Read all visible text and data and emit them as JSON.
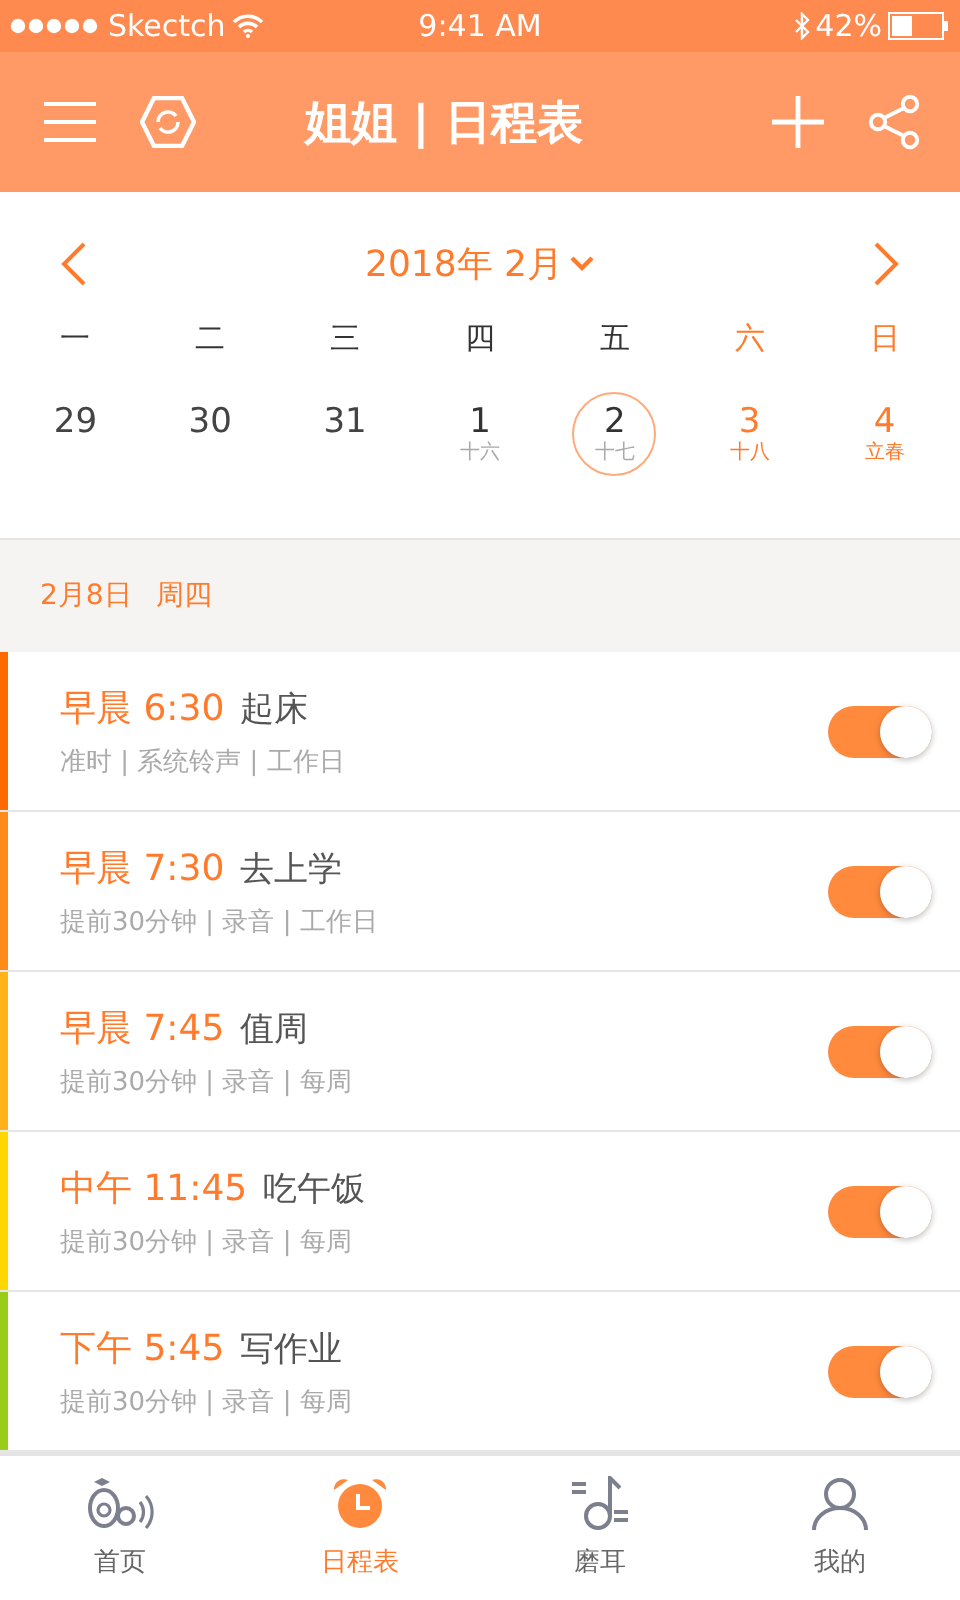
{
  "status_bar": {
    "carrier": "Skectch",
    "time": "9:41 AM",
    "battery": "42%"
  },
  "header": {
    "title": "姐姐 | 日程表"
  },
  "calendar": {
    "month": "2018年 2月",
    "weekdays": [
      {
        "label": "一",
        "weekend": false
      },
      {
        "label": "二",
        "weekend": false
      },
      {
        "label": "三",
        "weekend": false
      },
      {
        "label": "四",
        "weekend": false
      },
      {
        "label": "五",
        "weekend": false
      },
      {
        "label": "六",
        "weekend": true
      },
      {
        "label": "日",
        "weekend": true
      }
    ],
    "days": [
      {
        "day": "29",
        "weekend": false,
        "selected": false,
        "other_month": true
      },
      {
        "day": "30",
        "weekend": false,
        "selected": false,
        "other_month": true
      },
      {
        "day": "31",
        "weekend": false,
        "selected": false,
        "other_month": true
      },
      {
        "day": "1",
        "lunar": "十六",
        "weekend": false,
        "selected": false,
        "other_month": false
      },
      {
        "day": "2",
        "lunar": "十七",
        "weekend": false,
        "selected": true,
        "other_month": false
      },
      {
        "day": "3",
        "lunar": "十八",
        "weekend": true,
        "selected": false,
        "other_month": false
      },
      {
        "day": "4",
        "lunar": "立春",
        "weekend": true,
        "selected": false,
        "other_month": false
      }
    ]
  },
  "date_header": {
    "date": "2月8日",
    "weekday": "周四"
  },
  "alarms": [
    {
      "period": "早晨",
      "time": "6:30",
      "title": "起床",
      "details": "准时 | 系统铃声 | 工作日",
      "on": true,
      "color": "#ff6a00"
    },
    {
      "period": "早晨",
      "time": "7:30",
      "title": "去上学",
      "details": "提前30分钟 | 录音 | 工作日",
      "on": true,
      "color": "#ff8c1a"
    },
    {
      "period": "早晨",
      "time": "7:45",
      "title": "值周",
      "details": "提前30分钟 | 录音 | 每周",
      "on": true,
      "color": "#ffb21a"
    },
    {
      "period": "中午",
      "time": "11:45",
      "title": "吃午饭",
      "details": "提前30分钟 | 录音 | 每周",
      "on": true,
      "color": "#ffd700"
    },
    {
      "period": "下午",
      "time": "5:45",
      "title": "写作业",
      "details": "提前30分钟 | 录音 | 每周",
      "on": true,
      "color": "#9acd1a"
    }
  ],
  "tab_bar": [
    {
      "label": "首页",
      "kind": "home",
      "selected": false
    },
    {
      "label": "日程表",
      "kind": "alarm",
      "selected": true
    },
    {
      "label": "磨耳",
      "kind": "music",
      "selected": false
    },
    {
      "label": "我的",
      "kind": "profile",
      "selected": false
    }
  ]
}
